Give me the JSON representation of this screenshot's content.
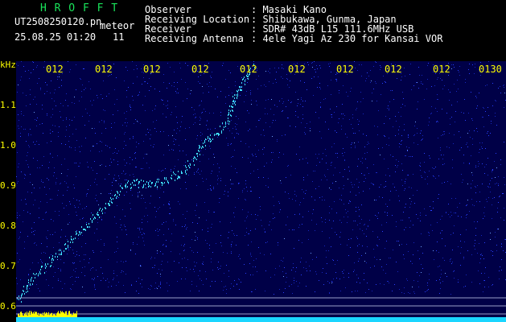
{
  "header": {
    "logo_letters": "H R O F F T",
    "filename": "UT2508250120.pn",
    "tag": "meteor",
    "timestamp": "25.08.25 01:20",
    "count": "11",
    "fields": [
      {
        "key": "Observer",
        "value": ": Masaki Kano"
      },
      {
        "key": "Receiving Location",
        "value": ": Shibukawa, Gunma, Japan"
      },
      {
        "key": "Receiver",
        "value": ": SDR# 43dB L15 111.6MHz USB"
      },
      {
        "key": "Receiving Antenna",
        "value": ": 4ele Yagi Az 230 for Kansai VOR"
      }
    ]
  },
  "spectrogram": {
    "y_unit": "kHz",
    "y_ticks": [
      "1.1",
      "1.0",
      "0.9",
      "0.8",
      "0.7",
      "0.6"
    ],
    "x_ticks": [
      "012",
      "012",
      "012",
      "012",
      "012",
      "012",
      "012",
      "012",
      "012",
      "0130"
    ],
    "colors": {
      "background": "#000047",
      "noise": "#2a40ff",
      "signal": "#40e0ff",
      "level": "#ffff00",
      "baseline": "#1ad6ff",
      "tick_label": "#ffff00"
    }
  }
}
